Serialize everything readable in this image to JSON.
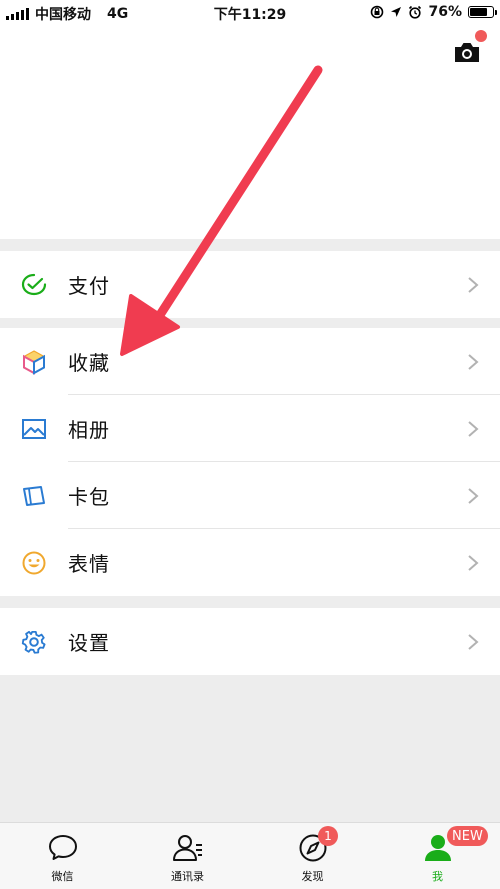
{
  "status_bar": {
    "carrier": "中国移动",
    "network": "4G",
    "time": "下午11:29",
    "battery_percent": "76%",
    "battery_level": 0.76
  },
  "header": {
    "camera_icon": "camera-icon"
  },
  "menu": {
    "pay": {
      "label": "支付",
      "icon": "wallet-icon",
      "color": "#1aad19"
    },
    "favorites": {
      "label": "收藏",
      "icon": "cube-icon"
    },
    "album": {
      "label": "相册",
      "icon": "image-icon",
      "color": "#2a7bd2"
    },
    "cards": {
      "label": "卡包",
      "icon": "card-icon",
      "color": "#2a7bd2"
    },
    "stickers": {
      "label": "表情",
      "icon": "smiley-icon",
      "color": "#f0a82e"
    },
    "settings": {
      "label": "设置",
      "icon": "gear-icon",
      "color": "#2a7bd2"
    }
  },
  "tabbar": {
    "chats": {
      "label": "微信",
      "icon": "chat-bubble-icon"
    },
    "contacts": {
      "label": "通讯录",
      "icon": "contacts-icon"
    },
    "discover": {
      "label": "发现",
      "icon": "compass-icon",
      "badge": "1"
    },
    "me": {
      "label": "我",
      "icon": "person-icon",
      "badge": "NEW"
    }
  },
  "colors": {
    "accent_green": "#1aad19",
    "badge_red": "#f05a5a",
    "annotation_arrow": "#f03c50"
  }
}
